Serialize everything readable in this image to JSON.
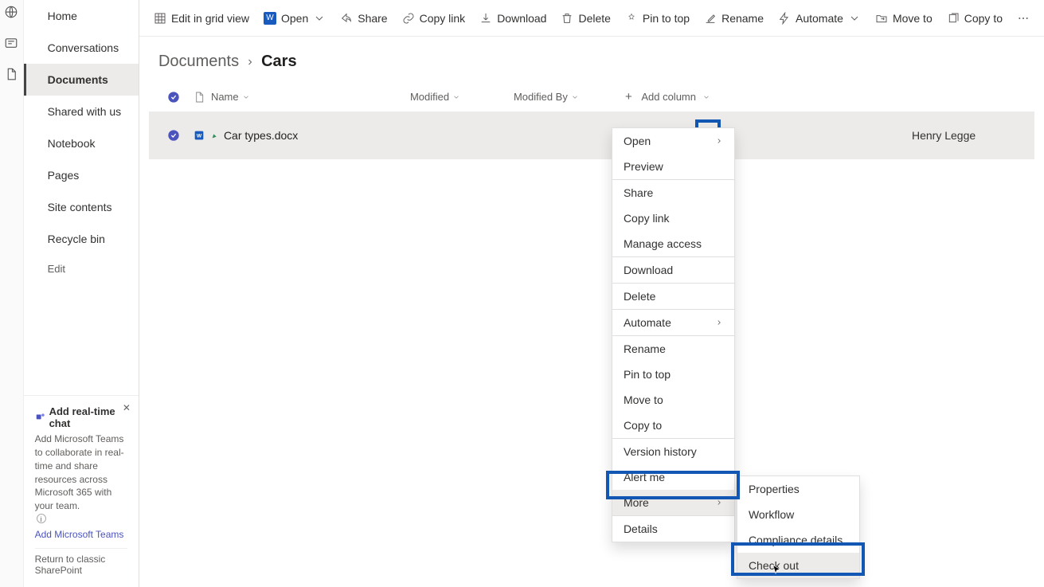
{
  "rail": {},
  "sidebar": {
    "items": [
      {
        "label": "Home"
      },
      {
        "label": "Conversations"
      },
      {
        "label": "Documents"
      },
      {
        "label": "Shared with us"
      },
      {
        "label": "Notebook"
      },
      {
        "label": "Pages"
      },
      {
        "label": "Site contents"
      },
      {
        "label": "Recycle bin"
      }
    ],
    "edit": "Edit",
    "promo": {
      "title": "Add real-time chat",
      "body": "Add Microsoft Teams to collaborate in real-time and share resources across Microsoft 365 with your team.",
      "link": "Add Microsoft Teams",
      "return": "Return to classic SharePoint"
    }
  },
  "commands": {
    "edit_grid": "Edit in grid view",
    "open": "Open",
    "share": "Share",
    "copy_link": "Copy link",
    "download": "Download",
    "delete": "Delete",
    "pin": "Pin to top",
    "rename": "Rename",
    "automate": "Automate",
    "move": "Move to",
    "copy_to": "Copy to"
  },
  "breadcrumb": {
    "parent": "Documents",
    "current": "Cars"
  },
  "columns": {
    "name": "Name",
    "modified": "Modified",
    "modified_by": "Modified By",
    "add": "Add column"
  },
  "rows": [
    {
      "name": "Car types.docx",
      "modified_by": "Henry Legge"
    }
  ],
  "context_menu": {
    "items": [
      {
        "label": "Open",
        "sub": true,
        "group": 0
      },
      {
        "label": "Preview",
        "group": 0
      },
      {
        "label": "Share",
        "group": 1
      },
      {
        "label": "Copy link",
        "group": 1
      },
      {
        "label": "Manage access",
        "group": 1
      },
      {
        "label": "Download",
        "group": 2
      },
      {
        "label": "Delete",
        "group": 3
      },
      {
        "label": "Automate",
        "sub": true,
        "group": 4
      },
      {
        "label": "Rename",
        "group": 5
      },
      {
        "label": "Pin to top",
        "group": 5
      },
      {
        "label": "Move to",
        "group": 5
      },
      {
        "label": "Copy to",
        "group": 5
      },
      {
        "label": "Version history",
        "group": 6
      },
      {
        "label": "Alert me",
        "group": 6
      },
      {
        "label": "More",
        "sub": true,
        "hovered": true,
        "group": 6
      },
      {
        "label": "Details",
        "group": 7
      }
    ]
  },
  "more_submenu": {
    "items": [
      {
        "label": "Properties"
      },
      {
        "label": "Workflow"
      },
      {
        "label": "Compliance details"
      },
      {
        "label": "Check out",
        "hovered": true
      }
    ]
  }
}
